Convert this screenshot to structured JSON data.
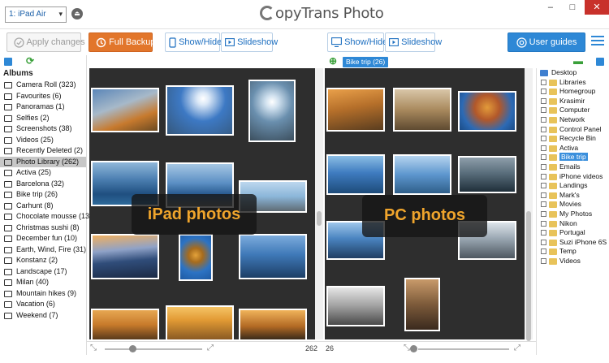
{
  "titlebar": {
    "device": "1: iPad Air",
    "app_title": "CopyTrans Photo",
    "app_title_rest": "opyTrans Photo",
    "minimize": "–",
    "maximize": "□",
    "close": "✕"
  },
  "toolbar": {
    "apply_changes": "Apply changes",
    "full_backup": "Full Backup",
    "left_show_hide": "Show/Hide",
    "left_slideshow": "Slideshow",
    "right_show_hide": "Show/Hide",
    "right_slideshow": "Slideshow",
    "user_guides": "User guides"
  },
  "sidebar": {
    "header": "Albums",
    "albums": [
      {
        "label": "Camera Roll (323)",
        "icon": "camera-icon"
      },
      {
        "label": "Favourites (6)",
        "icon": "heart-icon"
      },
      {
        "label": "Panoramas (1)",
        "icon": "panorama-icon"
      },
      {
        "label": "Selfies (2)",
        "icon": "selfie-icon"
      },
      {
        "label": "Screenshots (38)",
        "icon": "screenshot-icon"
      },
      {
        "label": "Videos (25)",
        "icon": "video-icon"
      },
      {
        "label": "Recently Deleted (2)",
        "icon": "trash-icon"
      },
      {
        "label": "Photo Library (262)",
        "icon": "camera-icon",
        "active": true
      },
      {
        "label": "Activa (25)",
        "icon": "album-icon"
      },
      {
        "label": "Barcelona (32)",
        "icon": "album-icon"
      },
      {
        "label": "Bike trip (26)",
        "icon": "album-icon"
      },
      {
        "label": "Carhunt (8)",
        "icon": "album-icon"
      },
      {
        "label": "Chocolate mousse (13)",
        "icon": "album-icon"
      },
      {
        "label": "Christmas sushi (8)",
        "icon": "album-icon"
      },
      {
        "label": "December fun (10)",
        "icon": "album-icon"
      },
      {
        "label": "Earth, Wind, Fire (31)",
        "icon": "album-icon"
      },
      {
        "label": "Konstanz (2)",
        "icon": "album-icon"
      },
      {
        "label": "Landscape (17)",
        "icon": "album-icon"
      },
      {
        "label": "Milan (40)",
        "icon": "album-icon"
      },
      {
        "label": "Mountain hikes (9)",
        "icon": "album-icon"
      },
      {
        "label": "Vacation (6)",
        "icon": "album-icon"
      },
      {
        "label": "Weekend (7)",
        "icon": "album-icon"
      }
    ]
  },
  "left_pane": {
    "overlay": "iPad photos",
    "count": "262"
  },
  "right_pane": {
    "album_tag": "Bike trip (26)",
    "overlay": "PC photos",
    "count": "26"
  },
  "tree": {
    "root": "Desktop",
    "items": [
      {
        "label": "Libraries",
        "selected": false
      },
      {
        "label": "Homegroup",
        "selected": false
      },
      {
        "label": "Krasimir",
        "selected": false
      },
      {
        "label": "Computer",
        "selected": false
      },
      {
        "label": "Network",
        "selected": false
      },
      {
        "label": "Control Panel",
        "selected": false
      },
      {
        "label": "Recycle Bin",
        "selected": false
      },
      {
        "label": "Activa",
        "selected": false
      },
      {
        "label": "Bike trip",
        "selected": true
      },
      {
        "label": "Emails",
        "selected": false
      },
      {
        "label": "iPhone videos",
        "selected": false
      },
      {
        "label": "Landings",
        "selected": false
      },
      {
        "label": "Mark's",
        "selected": false
      },
      {
        "label": "Movies",
        "selected": false
      },
      {
        "label": "My Photos",
        "selected": false
      },
      {
        "label": "Nikon",
        "selected": false
      },
      {
        "label": "Portugal",
        "selected": false
      },
      {
        "label": "Suzi iPhone 6S",
        "selected": false
      },
      {
        "label": "Temp",
        "selected": false
      },
      {
        "label": "Videos",
        "selected": false
      }
    ]
  },
  "colors": {
    "accent": "#2e88d6",
    "backup": "#e2762b",
    "overlay_text": "#f0a52c",
    "pane_bg": "#2e2e2e"
  }
}
